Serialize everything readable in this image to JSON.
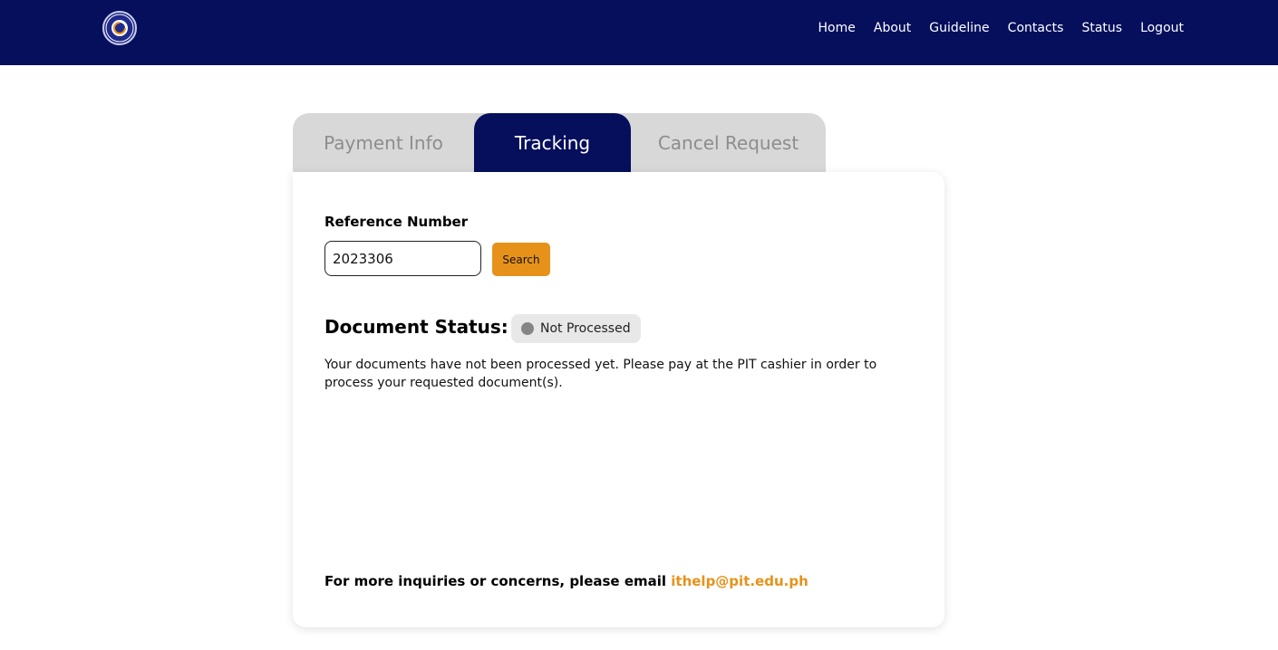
{
  "header": {
    "logo_icon": "institute-seal-icon",
    "nav": [
      "Home",
      "About",
      "Guideline",
      "Contacts",
      "Status",
      "Logout"
    ]
  },
  "tabs": [
    {
      "label": "Payment Info",
      "active": false
    },
    {
      "label": "Tracking",
      "active": true
    },
    {
      "label": "Cancel Request",
      "active": false
    }
  ],
  "tracking": {
    "reference_label": "Reference Number",
    "reference_value": "2023306",
    "search_label": "Search",
    "status_title": "Document Status:",
    "status_badge": "Not Processed",
    "status_message": "Your documents have not been processed yet. Please pay at the PIT cashier in order to process your requested document(s).",
    "footer_text": "For more inquiries or concerns, please email",
    "footer_email": "ithelp@pit.edu.ph"
  },
  "colors": {
    "navbar": "#050f5c",
    "accent": "#e6921a",
    "tab_inactive": "#d8d8d8",
    "status_dot": "#858585"
  }
}
